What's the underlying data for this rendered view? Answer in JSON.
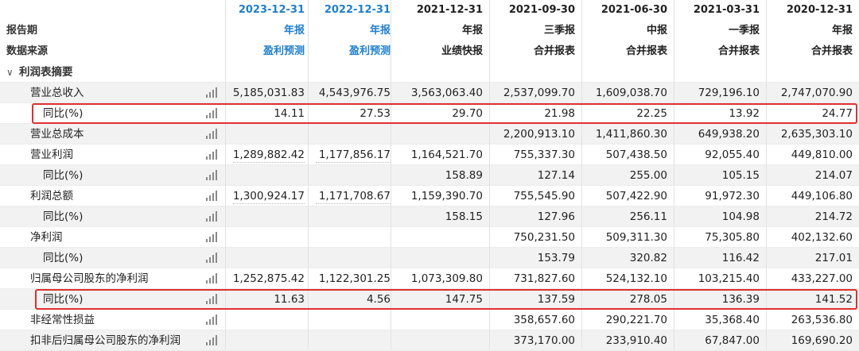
{
  "header": {
    "row1_label": "",
    "row2_label": "报告期",
    "row3_label": "数据来源",
    "columns": [
      {
        "date": "2023-12-31",
        "type": "年报",
        "source": "盈利预测",
        "highlight": true
      },
      {
        "date": "2022-12-31",
        "type": "年报",
        "source": "盈利预测",
        "highlight": true
      },
      {
        "date": "2021-12-31",
        "type": "年报",
        "source": "业绩快报",
        "highlight": false
      },
      {
        "date": "2021-09-30",
        "type": "三季报",
        "source": "合并报表",
        "highlight": false
      },
      {
        "date": "2021-06-30",
        "type": "中报",
        "source": "合并报表",
        "highlight": false
      },
      {
        "date": "2021-03-31",
        "type": "一季报",
        "source": "合并报表",
        "highlight": false
      },
      {
        "date": "2020-12-31",
        "type": "年报",
        "source": "合并报表",
        "highlight": false
      }
    ]
  },
  "section": {
    "label": "利润表摘要"
  },
  "rows": [
    {
      "label": "营业总收入",
      "indent": 1,
      "values": [
        "5,185,031.83",
        "4,543,976.75",
        "3,563,063.40",
        "2,537,099.70",
        "1,609,038.70",
        "729,196.10",
        "2,747,070.90"
      ]
    },
    {
      "label": "同比(%)",
      "indent": 2,
      "values": [
        "14.11",
        "27.53",
        "29.70",
        "21.98",
        "22.25",
        "13.92",
        "24.77"
      ]
    },
    {
      "label": "营业总成本",
      "indent": 1,
      "values": [
        "",
        "",
        "",
        "2,200,913.10",
        "1,411,860.30",
        "649,938.20",
        "2,635,303.10"
      ]
    },
    {
      "label": "营业利润",
      "indent": 1,
      "values": [
        "1,289,882.42",
        "1,177,856.17",
        "1,164,521.70",
        "755,337.30",
        "507,438.50",
        "92,055.40",
        "449,810.00"
      ]
    },
    {
      "label": "同比(%)",
      "indent": 2,
      "values": [
        "",
        "",
        "158.89",
        "127.14",
        "255.00",
        "105.15",
        "214.07"
      ]
    },
    {
      "label": "利润总额",
      "indent": 1,
      "values": [
        "1,300,924.17",
        "1,171,708.67",
        "1,159,390.70",
        "755,545.90",
        "507,422.90",
        "91,972.30",
        "449,106.80"
      ]
    },
    {
      "label": "同比(%)",
      "indent": 2,
      "values": [
        "",
        "",
        "158.15",
        "127.96",
        "256.11",
        "104.98",
        "214.72"
      ]
    },
    {
      "label": "净利润",
      "indent": 1,
      "values": [
        "",
        "",
        "",
        "750,231.50",
        "509,311.30",
        "75,305.80",
        "402,132.60"
      ]
    },
    {
      "label": "同比(%)",
      "indent": 2,
      "values": [
        "",
        "",
        "",
        "153.79",
        "320.82",
        "116.42",
        "217.01"
      ]
    },
    {
      "label": "归属母公司股东的净利润",
      "indent": 1,
      "values": [
        "1,252,875.42",
        "1,122,301.25",
        "1,073,309.80",
        "731,827.60",
        "524,132.10",
        "103,215.40",
        "433,227.00"
      ]
    },
    {
      "label": "同比(%)",
      "indent": 2,
      "values": [
        "11.63",
        "4.56",
        "147.75",
        "137.59",
        "278.05",
        "136.39",
        "141.52"
      ]
    },
    {
      "label": "非经常性损益",
      "indent": 1,
      "values": [
        "",
        "",
        "",
        "358,657.60",
        "290,221.70",
        "35,368.40",
        "263,536.80"
      ]
    },
    {
      "label": "扣非后归属母公司股东的净利润",
      "indent": 1,
      "values": [
        "",
        "",
        "",
        "373,170.00",
        "233,910.40",
        "67,847.00",
        "169,690.20"
      ]
    }
  ],
  "colors": {
    "accent_blue": "#1f7fd0",
    "highlight_red": "#e03030",
    "alt_row": "#f2f2f2"
  },
  "icons": {
    "row_chart": "bar-chart-icon",
    "section_toggle": "chevron-down-icon"
  }
}
